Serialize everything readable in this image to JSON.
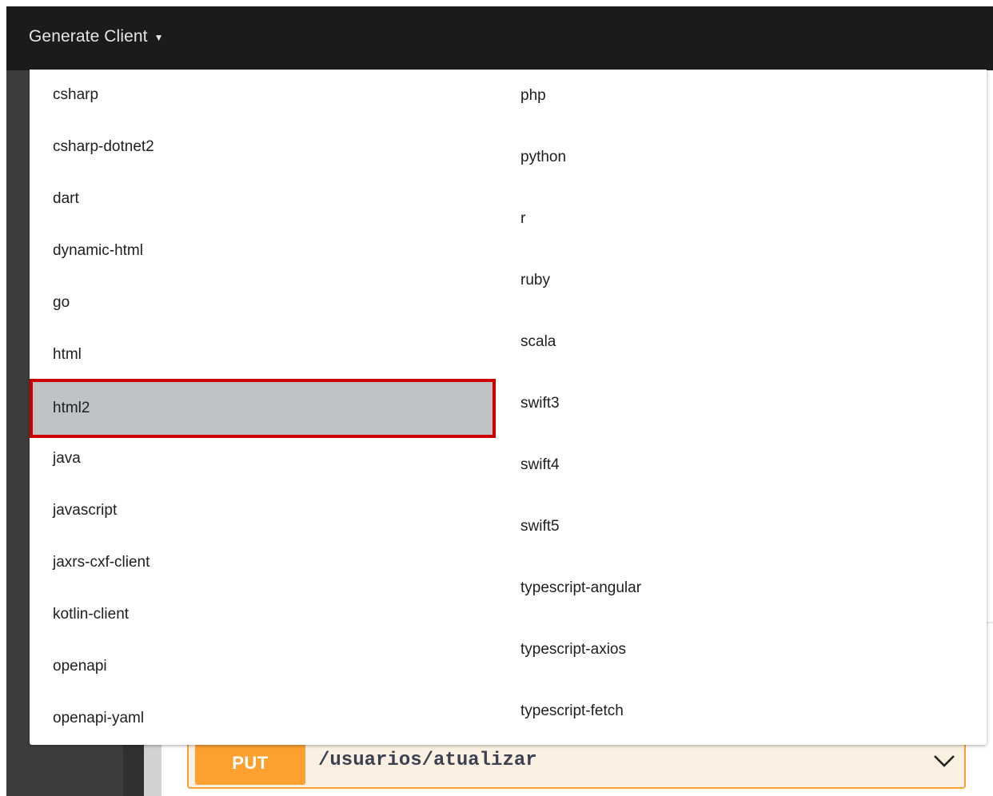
{
  "header": {
    "generate_client_label": "Generate Client",
    "caret": "▼"
  },
  "dropdown": {
    "selected": "html2",
    "left_items": [
      "csharp",
      "csharp-dotnet2",
      "dart",
      "dynamic-html",
      "go",
      "html",
      "html2",
      "java",
      "javascript",
      "jaxrs-cxf-client",
      "kotlin-client",
      "openapi",
      "openapi-yaml"
    ],
    "right_items": [
      "php",
      "python",
      "r",
      "ruby",
      "scala",
      "swift3",
      "swift4",
      "swift5",
      "typescript-angular",
      "typescript-axios",
      "typescript-fetch"
    ]
  },
  "endpoint": {
    "method": "PUT",
    "path": "/usuarios/atualizar",
    "method_color": "#fca130",
    "chevron_icon": "chevron-down-icon"
  },
  "colors": {
    "topbar": "#1b1b1b",
    "selection_border": "#cc0000",
    "selection_bg": "#bfc3c6"
  }
}
